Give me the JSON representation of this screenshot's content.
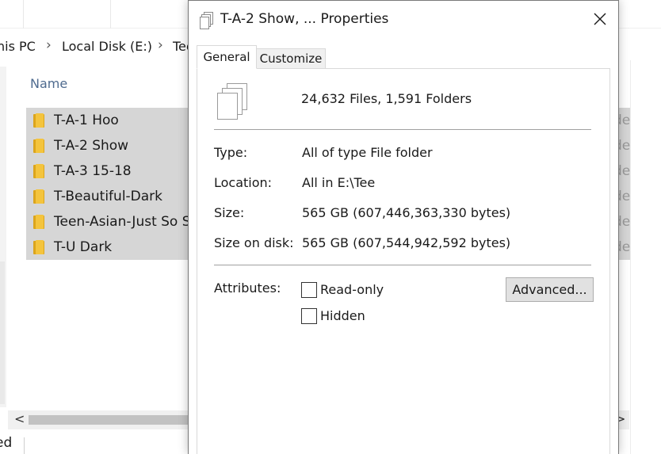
{
  "explorer": {
    "breadcrumb": [
      "his PC",
      "Local Disk (E:)",
      "Tee"
    ],
    "column_name": "Name",
    "rows": [
      {
        "name": "T-A-1 Hoo"
      },
      {
        "name": "T-A-2 Show"
      },
      {
        "name": "T-A-3 15-18"
      },
      {
        "name": "T-Beautiful-Dark"
      },
      {
        "name": "Teen-Asian-Just So Sc"
      },
      {
        "name": "T-U Dark"
      }
    ],
    "right_fragments": [
      "de",
      "de",
      "de",
      "de",
      "de",
      "de"
    ],
    "scroll_left": "<",
    "scroll_right": ">",
    "status_fragment": "ed",
    "icon_folder": "folder-icon"
  },
  "dialog": {
    "title": "T-A-2 Show, ... Properties",
    "close_glyph": "✕",
    "tabs": [
      "General",
      "Customize"
    ],
    "summary": "24,632 Files, 1,591 Folders",
    "fields": {
      "type_label": "Type:",
      "type_value": "All of type File folder",
      "location_label": "Location:",
      "location_value": "All in E:\\Tee",
      "size_label": "Size:",
      "size_value": "565 GB (607,446,363,330 bytes)",
      "size_on_disk_label": "Size on disk:",
      "size_on_disk_value": "565 GB (607,544,942,592 bytes)"
    },
    "attributes_label": "Attributes:",
    "readonly_label": "Read-only",
    "hidden_label": "Hidden",
    "readonly_checked": false,
    "hidden_checked": false,
    "advanced_label": "Advanced..."
  }
}
